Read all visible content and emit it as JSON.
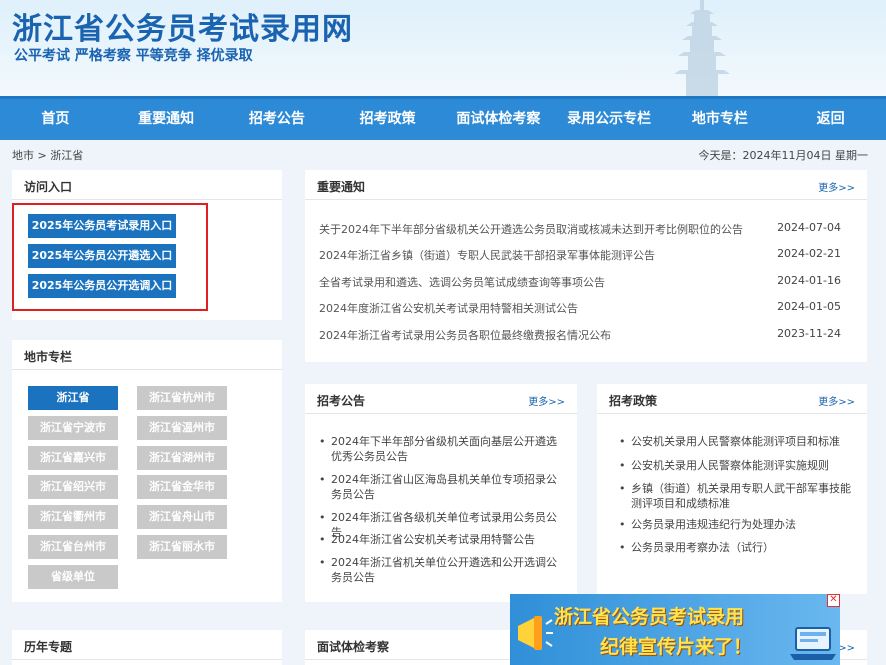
{
  "header": {
    "title": "浙江省公务员考试录用网",
    "slogan": "公平考试 严格考察 平等竞争 择优录取"
  },
  "nav": [
    "首页",
    "重要通知",
    "招考公告",
    "招考政策",
    "面试体检考察",
    "录用公示专栏",
    "地市专栏",
    "返回"
  ],
  "crumb": "地市 > 浙江省",
  "today": "今天是：2024年11月04日 星期一",
  "access": {
    "title": "访问入口",
    "buttons": [
      "2025年公务员考试录用入口",
      "2025年公务员公开遴选入口",
      "2025年公务员公开选调入口"
    ]
  },
  "city": {
    "title": "地市专栏",
    "items": [
      "浙江省",
      "浙江省杭州市",
      "浙江省宁波市",
      "浙江省温州市",
      "浙江省嘉兴市",
      "浙江省湖州市",
      "浙江省绍兴市",
      "浙江省金华市",
      "浙江省衢州市",
      "浙江省舟山市",
      "浙江省台州市",
      "浙江省丽水市",
      "省级单位"
    ]
  },
  "notice": {
    "title": "重要通知",
    "more": "更多>>",
    "rows": [
      {
        "text": "关于2024年下半年部分省级机关公开遴选公务员取消或核减未达到开考比例职位的公告",
        "date": "2024-07-04"
      },
      {
        "text": "2024年浙江省乡镇（街道）专职人民武装干部招录军事体能测评公告",
        "date": "2024-02-21"
      },
      {
        "text": "全省考试录用和遴选、选调公务员笔试成绩查询等事项公告",
        "date": "2024-01-16"
      },
      {
        "text": "2024年度浙江省公安机关考试录用特警相关测试公告",
        "date": "2024-01-05"
      },
      {
        "text": "2024年浙江省考试录用公务员各职位最终缴费报名情况公布",
        "date": "2023-11-24"
      }
    ]
  },
  "exam": {
    "title": "招考公告",
    "more": "更多>>",
    "items": [
      "2024年下半年部分省级机关面向基层公开遴选优秀公务员公告",
      "2024年浙江省山区海岛县机关单位专项招录公务员公告",
      "2024年浙江省各级机关单位考试录用公务员公告",
      "2024年浙江省公安机关考试录用特警公告",
      "2024年浙江省机关单位公开遴选和公开选调公务员公告"
    ]
  },
  "policy": {
    "title": "招考政策",
    "more": "更多>>",
    "items": [
      "公安机关录用人民警察体能测评项目和标准",
      "公安机关录用人民警察体能测评实施规则",
      "乡镇（街道）机关录用专职人武干部军事技能测评项目和成绩标准",
      "公务员录用违规违纪行为处理办法",
      "公务员录用考察办法（试行）"
    ]
  },
  "history": {
    "title": "历年专题"
  },
  "interview": {
    "title": "面试体检考察",
    "more": "更多>>"
  },
  "ad": {
    "line1": "浙江省公务员考试录用",
    "line2": "纪律宣传片来了！",
    "close": "✕"
  },
  "colors": {
    "nav": "#2d8ad6",
    "button": "#1b73c0",
    "highlight_border": "#e02020"
  }
}
